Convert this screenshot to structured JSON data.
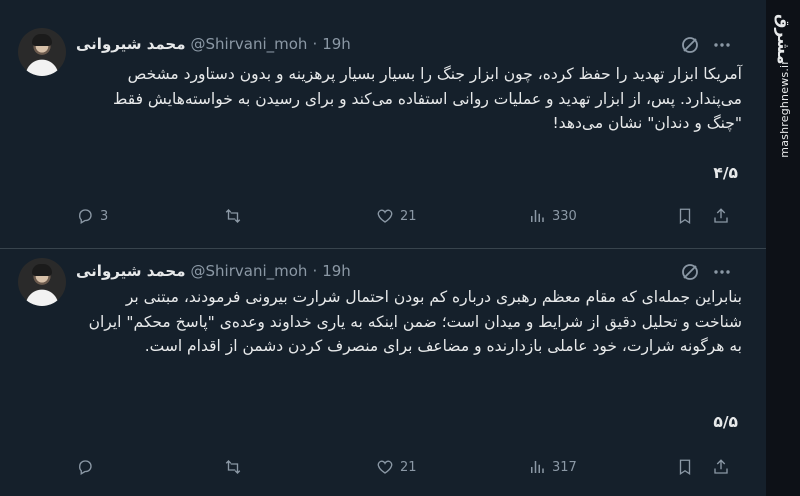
{
  "tweets": [
    {
      "author_name": "محمد شیروانی",
      "handle": "@Shirvani_moh",
      "separator": "·",
      "time": "19h",
      "body": "آمریکا ابزار تهدید را حفظ کرده، چون ابزار جنگ را بسیار بسیار پرهزینه و بدون دستاورد مشخص می‌پندارد. پس، از ابزار تهدید و عملیات روانی استفاده می‌کند و برای رسیدن به خواسته‌هایش فقط \"چنگ و دندان\" نشان می‌دهد!",
      "thread_counter": "۴/۵",
      "replies": "3",
      "retweets": "",
      "likes": "21",
      "views": "330"
    },
    {
      "author_name": "محمد شیروانی",
      "handle": "@Shirvani_moh",
      "separator": "·",
      "time": "19h",
      "body": "بنابراین جمله‌ای که مقام معظم رهبری درباره کم بودن احتمال شرارت بیرونی فرمودند، مبتنی بر شناخت و تحلیل دقیق از شرایط و میدان است؛ ضمن اینکه به یاری خداوند وعده‌ی \"پاسخ محکم\" ایران به هرگونه شرارت، خود عاملی بازدارنده و مضاعف برای منصرف کردن دشمن از اقدام است.",
      "thread_counter": "۵/۵",
      "replies": "",
      "retweets": "",
      "likes": "21",
      "views": "317"
    }
  ],
  "watermark": {
    "logo": "مشرق",
    "url": "mashreghnews.ir"
  },
  "icons": {
    "reply": "reply-icon",
    "retweet": "retweet-icon",
    "like": "heart-icon",
    "views": "views-icon",
    "bookmark": "bookmark-icon",
    "share": "share-icon",
    "grok": "grok-icon",
    "more": "more-icon"
  },
  "colors": {
    "background": "#15202b",
    "text": "#e7e9ea",
    "secondary": "#8b98a5",
    "divider": "#38444d"
  }
}
